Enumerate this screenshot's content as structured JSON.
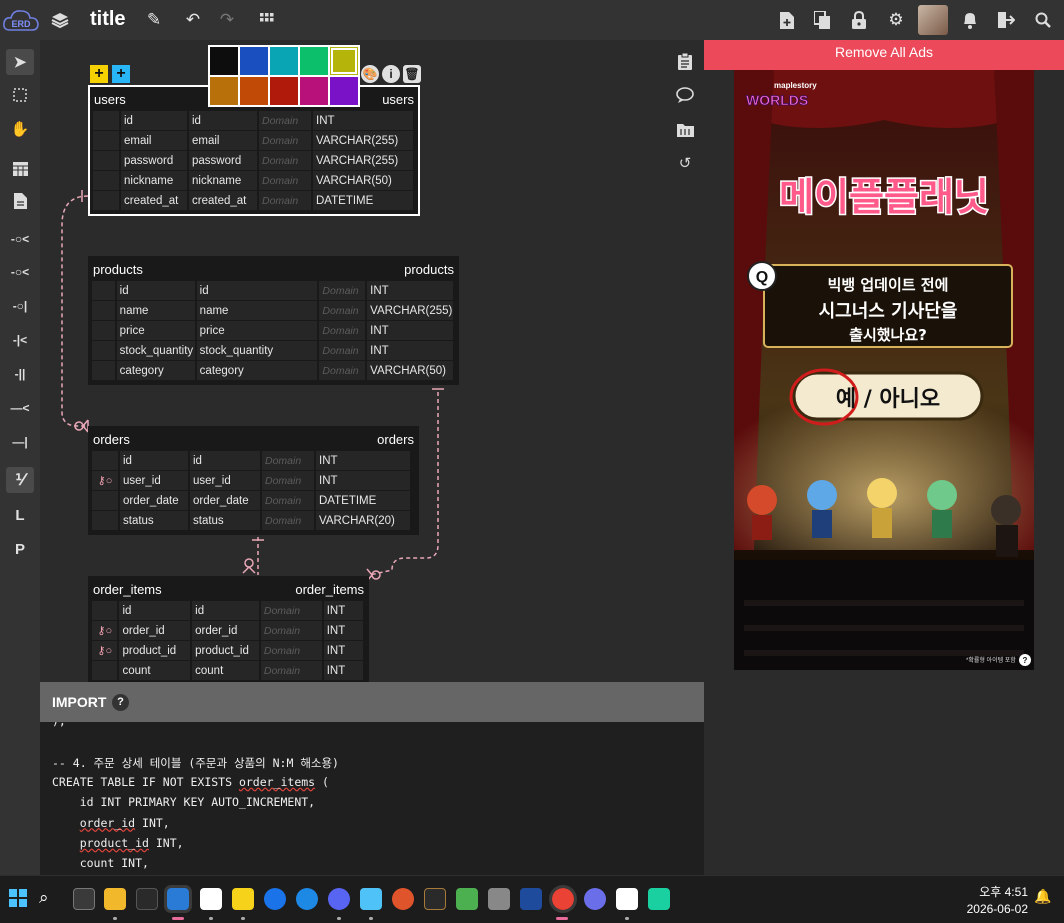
{
  "app": {
    "title": "title",
    "logo_text": "ERD"
  },
  "canvas_tables": [
    {
      "id": "users",
      "name": "users",
      "comment": "users",
      "columns": [
        {
          "pk": "",
          "name": "id",
          "logical": "id",
          "domain": "Domain",
          "type": "INT"
        },
        {
          "pk": "",
          "name": "email",
          "logical": "email",
          "domain": "Domain",
          "type": "VARCHAR(255)"
        },
        {
          "pk": "",
          "name": "password",
          "logical": "password",
          "domain": "Domain",
          "type": "VARCHAR(255)"
        },
        {
          "pk": "",
          "name": "nickname",
          "logical": "nickname",
          "domain": "Domain",
          "type": "VARCHAR(50)"
        },
        {
          "pk": "",
          "name": "created_at",
          "logical": "created_at",
          "domain": "Domain",
          "type": "DATETIME"
        }
      ]
    },
    {
      "id": "products",
      "name": "products",
      "comment": "products",
      "columns": [
        {
          "pk": "",
          "name": "id",
          "logical": "id",
          "domain": "Domain",
          "type": "INT"
        },
        {
          "pk": "",
          "name": "name",
          "logical": "name",
          "domain": "Domain",
          "type": "VARCHAR(255)"
        },
        {
          "pk": "",
          "name": "price",
          "logical": "price",
          "domain": "Domain",
          "type": "INT"
        },
        {
          "pk": "",
          "name": "stock_quantity",
          "logical": "stock_quantity",
          "domain": "Domain",
          "type": "INT"
        },
        {
          "pk": "",
          "name": "category",
          "logical": "category",
          "domain": "Domain",
          "type": "VARCHAR(50)"
        }
      ]
    },
    {
      "id": "orders",
      "name": "orders",
      "comment": "orders",
      "columns": [
        {
          "pk": "",
          "name": "id",
          "logical": "id",
          "domain": "Domain",
          "type": "INT"
        },
        {
          "pk": "fk",
          "name": "user_id",
          "logical": "user_id",
          "domain": "Domain",
          "type": "INT"
        },
        {
          "pk": "",
          "name": "order_date",
          "logical": "order_date",
          "domain": "Domain",
          "type": "DATETIME"
        },
        {
          "pk": "",
          "name": "status",
          "logical": "status",
          "domain": "Domain",
          "type": "VARCHAR(20)"
        }
      ]
    },
    {
      "id": "order_items",
      "name": "order_items",
      "comment": "order_items",
      "columns": [
        {
          "pk": "",
          "name": "id",
          "logical": "id",
          "domain": "Domain",
          "type": "INT"
        },
        {
          "pk": "fk",
          "name": "order_id",
          "logical": "order_id",
          "domain": "Domain",
          "type": "INT"
        },
        {
          "pk": "fk",
          "name": "product_id",
          "logical": "product_id",
          "domain": "Domain",
          "type": "INT"
        },
        {
          "pk": "",
          "name": "count",
          "logical": "count",
          "domain": "Domain",
          "type": "INT"
        }
      ]
    }
  ],
  "palette": [
    "#0d0d0d",
    "#1a4fbf",
    "#0aa5b4",
    "#0bbf6b",
    "#b5b40a",
    "#b7700a",
    "#c24a07",
    "#b01a0a",
    "#b8127a",
    "#7a12c7"
  ],
  "colors": {
    "relation": "#e8a7b6",
    "remove_ads": "#ec4a5b",
    "selected_border": "#ffffff"
  },
  "import": {
    "label": "IMPORT",
    "help": "?"
  },
  "code_lines": [
    {
      "parts": [
        {
          "t": ");",
          "sq": false
        }
      ]
    },
    {
      "parts": [
        {
          "t": "",
          "sq": false
        }
      ]
    },
    {
      "parts": [
        {
          "t": "-- 4. 주문 상세 테이블 (주문과 상품의 N:M 해소용)",
          "sq": false
        }
      ]
    },
    {
      "parts": [
        {
          "t": "CREATE TABLE IF NOT EXISTS ",
          "sq": false
        },
        {
          "t": "order_items",
          "sq": true
        },
        {
          "t": " (",
          "sq": false
        }
      ]
    },
    {
      "parts": [
        {
          "t": "    id INT PRIMARY KEY AUTO_INCREMENT,",
          "sq": false
        }
      ]
    },
    {
      "parts": [
        {
          "t": "    ",
          "sq": false
        },
        {
          "t": "order_id",
          "sq": true
        },
        {
          "t": " INT,",
          "sq": false
        }
      ]
    },
    {
      "parts": [
        {
          "t": "    ",
          "sq": false
        },
        {
          "t": "product_id",
          "sq": true
        },
        {
          "t": " INT,",
          "sq": false
        }
      ]
    },
    {
      "parts": [
        {
          "t": "    count INT,",
          "sq": false
        }
      ]
    }
  ],
  "ad": {
    "remove_label": "Remove All Ads",
    "brand_top": "maplestory",
    "brand_main": "WORLDS",
    "headline": "메이플플래닛",
    "q_badge": "Q",
    "question_line1": "빅뱅 업데이트 전에",
    "question_line2": "시그너스 기사단을",
    "question_line3": "출시했나요?",
    "answer": "예 / 아니오",
    "footer": "*확률형 아이템 포함",
    "help": "?"
  },
  "taskbar": {
    "time": "오후 4:51",
    "date": "2026-06-02"
  }
}
